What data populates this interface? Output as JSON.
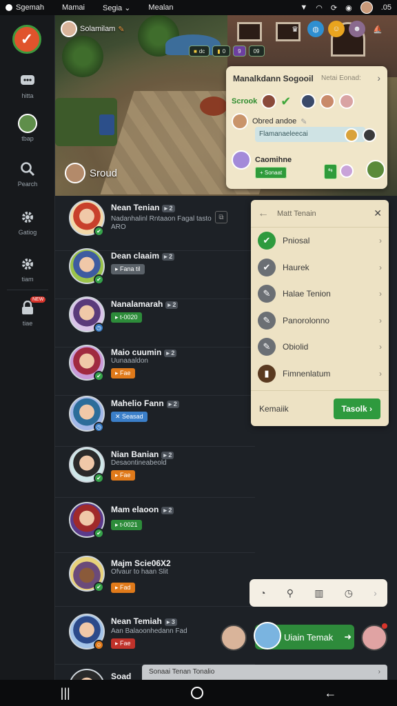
{
  "statusbar": {
    "items": [
      "Sgemah",
      "Mamai",
      "Segia",
      "Mealan"
    ],
    "time": ".05"
  },
  "sidebar": {
    "items": [
      {
        "label": "hitta",
        "icon": "chat-icon"
      },
      {
        "label": "tbap",
        "icon": "profile-avatar-icon"
      },
      {
        "label": "Pearch",
        "icon": "search-icon"
      },
      {
        "label": "Gatiog",
        "icon": "gear-icon"
      },
      {
        "label": "tiam",
        "icon": "settings-icon"
      },
      {
        "label": "tiae",
        "icon": "lock-icon",
        "badge": "NEW"
      }
    ]
  },
  "scene": {
    "player_name": "Solamilam",
    "label": "Sroud",
    "hud_pills": [
      "dc",
      "0",
      "9",
      "09"
    ]
  },
  "social_card": {
    "title": "Manalkdann Sogooil",
    "hint": "Netai Eonad:",
    "row1": "Scrook",
    "row2": "Obred andoe",
    "field": "Flamanaeleecai",
    "row3_title": "Caomihne",
    "row3_button": "Sonaat"
  },
  "friends": [
    {
      "name": "Nean Tenian",
      "level": "2",
      "sub": "Nadanhalinl Rntaaon Fagal tasto",
      "sub2": "ARO",
      "status_color": "#36a34a"
    },
    {
      "name": "Dean claaim",
      "level": "2",
      "tag": "Fana til",
      "tag_color": "#5a6168",
      "status_color": "#36a34a"
    },
    {
      "name": "Nanalamarah",
      "level": "2",
      "tag": "t-0020",
      "tag_color": "#2d8c3a",
      "status_color": "#3b7fc9"
    },
    {
      "name": "Maio cuumin",
      "level": "2",
      "sub": "Uunaaaldon",
      "tag": "Fae",
      "tag_color": "#e07a1a",
      "status_color": "#36a34a"
    },
    {
      "name": "Mahelio Fann",
      "level": "2",
      "tag": "Seasad",
      "tag_color": "#3b7fc9",
      "status_color": "#3b7fc9"
    },
    {
      "name": "Nian Banian",
      "level": "2",
      "sub": "Desaontineabeold",
      "tag": "Fae",
      "tag_color": "#e07a1a",
      "status_color": "#36a34a"
    },
    {
      "name": "Mam elaoon",
      "level": "2",
      "tag": "t-0021",
      "tag_color": "#2d8c3a",
      "status_color": "#36a34a"
    },
    {
      "name": "Majm Scie06X2",
      "level": "",
      "sub": "Ofvaur to haan Slit",
      "tag": "Fad",
      "tag_color": "#e07a1a",
      "status_color": "#36a34a"
    },
    {
      "name": "Nean Temiah",
      "level": "3",
      "sub": "Aan Balaoonhedann Fad",
      "tag": "Fae",
      "tag_color": "#c0322a",
      "status_color": "#e07a1a"
    },
    {
      "name": "Soad",
      "level": "",
      "status_color": "#36a34a"
    }
  ],
  "panel": {
    "title": "Matt Tenain",
    "options": [
      {
        "label": "Pniosal",
        "color": "#2e9a3e",
        "glyph": "✔"
      },
      {
        "label": "Haurek",
        "color": "#6b6f74",
        "glyph": "✔"
      },
      {
        "label": "Halae Tenion",
        "color": "#6b6f74",
        "glyph": "✎"
      },
      {
        "label": "Panorolonno",
        "color": "#6b6f74",
        "glyph": "✎"
      },
      {
        "label": "Obiolid",
        "color": "#6b6f74",
        "glyph": "✎"
      },
      {
        "label": "Fimnenlatum",
        "color": "#5a3a20",
        "glyph": "▮"
      }
    ],
    "footer_label": "Kemaiik",
    "footer_button": "Tasolk"
  },
  "invite": {
    "label": "Uiain Temak"
  },
  "bottom_strip": "Sonaai Tenan Tonalio",
  "colors": {
    "accent_green": "#2e9a3e",
    "panel_bg": "#ede2c4",
    "app_bg": "#1d2126"
  }
}
